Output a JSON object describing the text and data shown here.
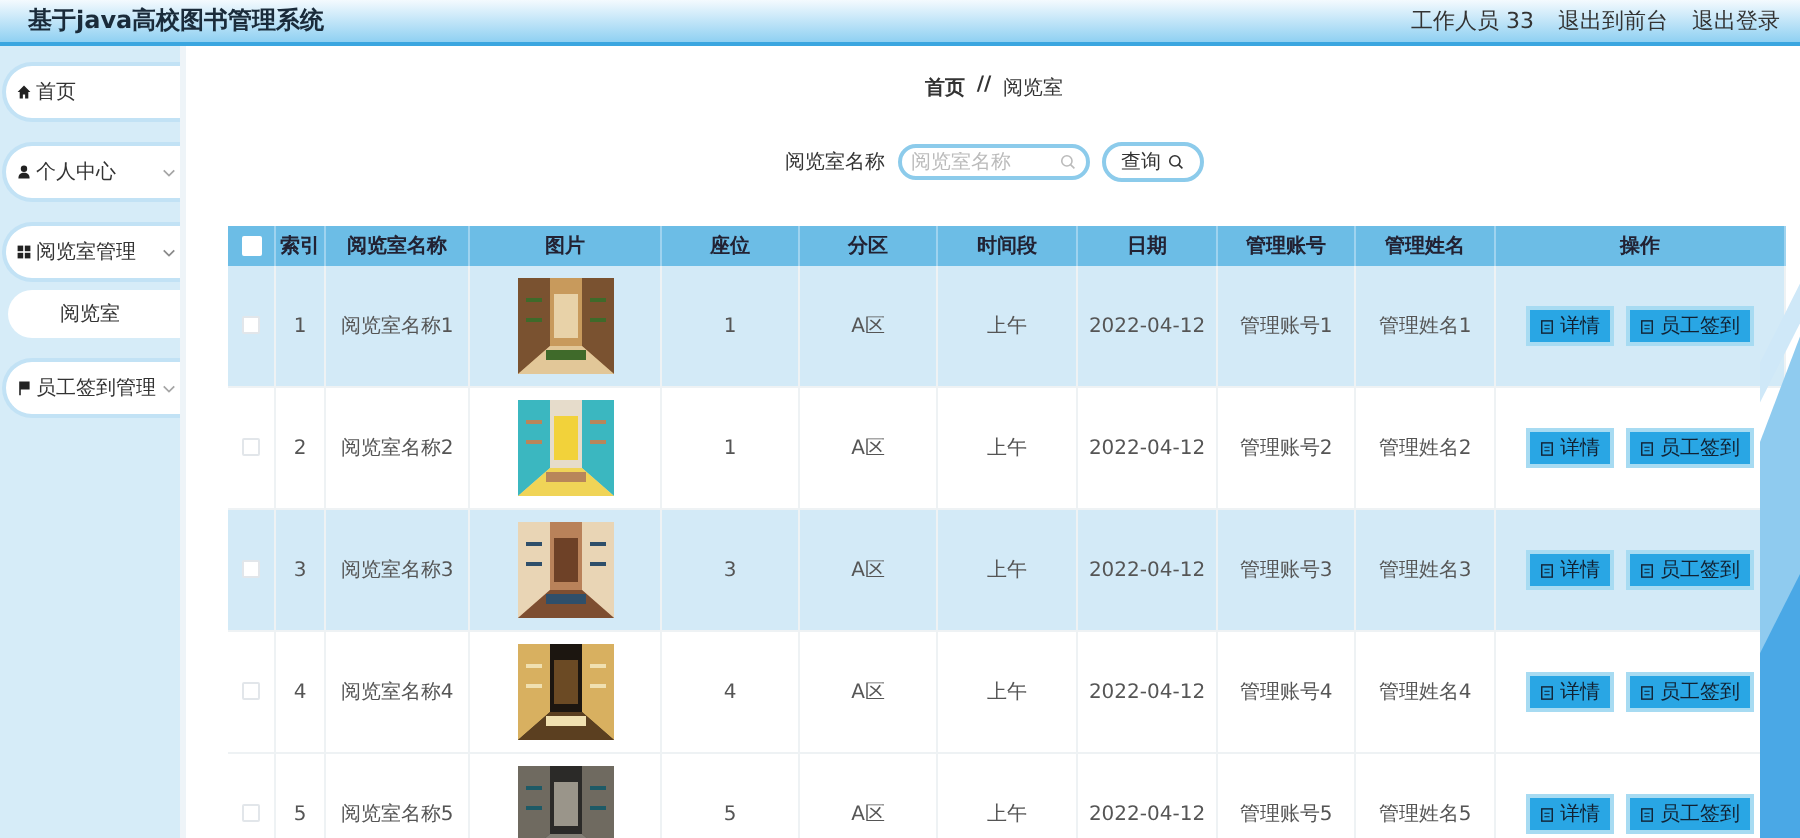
{
  "header": {
    "title": "基于java高校图书管理系统",
    "links": [
      "工作人员 33",
      "退出到前台",
      "退出登录"
    ]
  },
  "sidebar": {
    "items": [
      {
        "label": "首页"
      },
      {
        "label": "个人中心",
        "expanded": false
      },
      {
        "label": "阅览室管理",
        "expanded": true,
        "children": [
          {
            "label": "阅览室"
          }
        ]
      },
      {
        "label": "员工签到管理",
        "expanded": false
      }
    ]
  },
  "breadcrumb": {
    "items": [
      "首页",
      "阅览室"
    ],
    "separator": "//"
  },
  "search": {
    "label": "阅览室名称",
    "placeholder": "阅览室名称",
    "button": "查询"
  },
  "table": {
    "select_all_checked": false,
    "columns": [
      "索引",
      "阅览室名称",
      "图片",
      "座位",
      "分区",
      "时间段",
      "日期",
      "管理账号",
      "管理姓名",
      "操作"
    ],
    "rows": [
      {
        "index": "1",
        "name": "阅览室名称1",
        "seats": "1",
        "zone": "A区",
        "time": "上午",
        "date": "2022-04-12",
        "account": "管理账号1",
        "manager": "管理姓名1",
        "checked": false,
        "shaded": true,
        "actions": [
          "详情",
          "员工签到"
        ]
      },
      {
        "index": "2",
        "name": "阅览室名称2",
        "seats": "1",
        "zone": "A区",
        "time": "上午",
        "date": "2022-04-12",
        "account": "管理账号2",
        "manager": "管理姓名2",
        "checked": false,
        "shaded": false,
        "actions": [
          "详情",
          "员工签到"
        ]
      },
      {
        "index": "3",
        "name": "阅览室名称3",
        "seats": "3",
        "zone": "A区",
        "time": "上午",
        "date": "2022-04-12",
        "account": "管理账号3",
        "manager": "管理姓名3",
        "checked": false,
        "shaded": true,
        "actions": [
          "详情",
          "员工签到"
        ]
      },
      {
        "index": "4",
        "name": "阅览室名称4",
        "seats": "4",
        "zone": "A区",
        "time": "上午",
        "date": "2022-04-12",
        "account": "管理账号4",
        "manager": "管理姓名4",
        "checked": false,
        "shaded": false,
        "actions": [
          "详情",
          "员工签到"
        ]
      },
      {
        "index": "5",
        "name": "阅览室名称5",
        "seats": "5",
        "zone": "A区",
        "time": "上午",
        "date": "2022-04-12",
        "account": "管理账号5",
        "manager": "管理姓名5",
        "checked": false,
        "shaded": false,
        "actions": [
          "详情",
          "员工签到"
        ]
      }
    ]
  }
}
